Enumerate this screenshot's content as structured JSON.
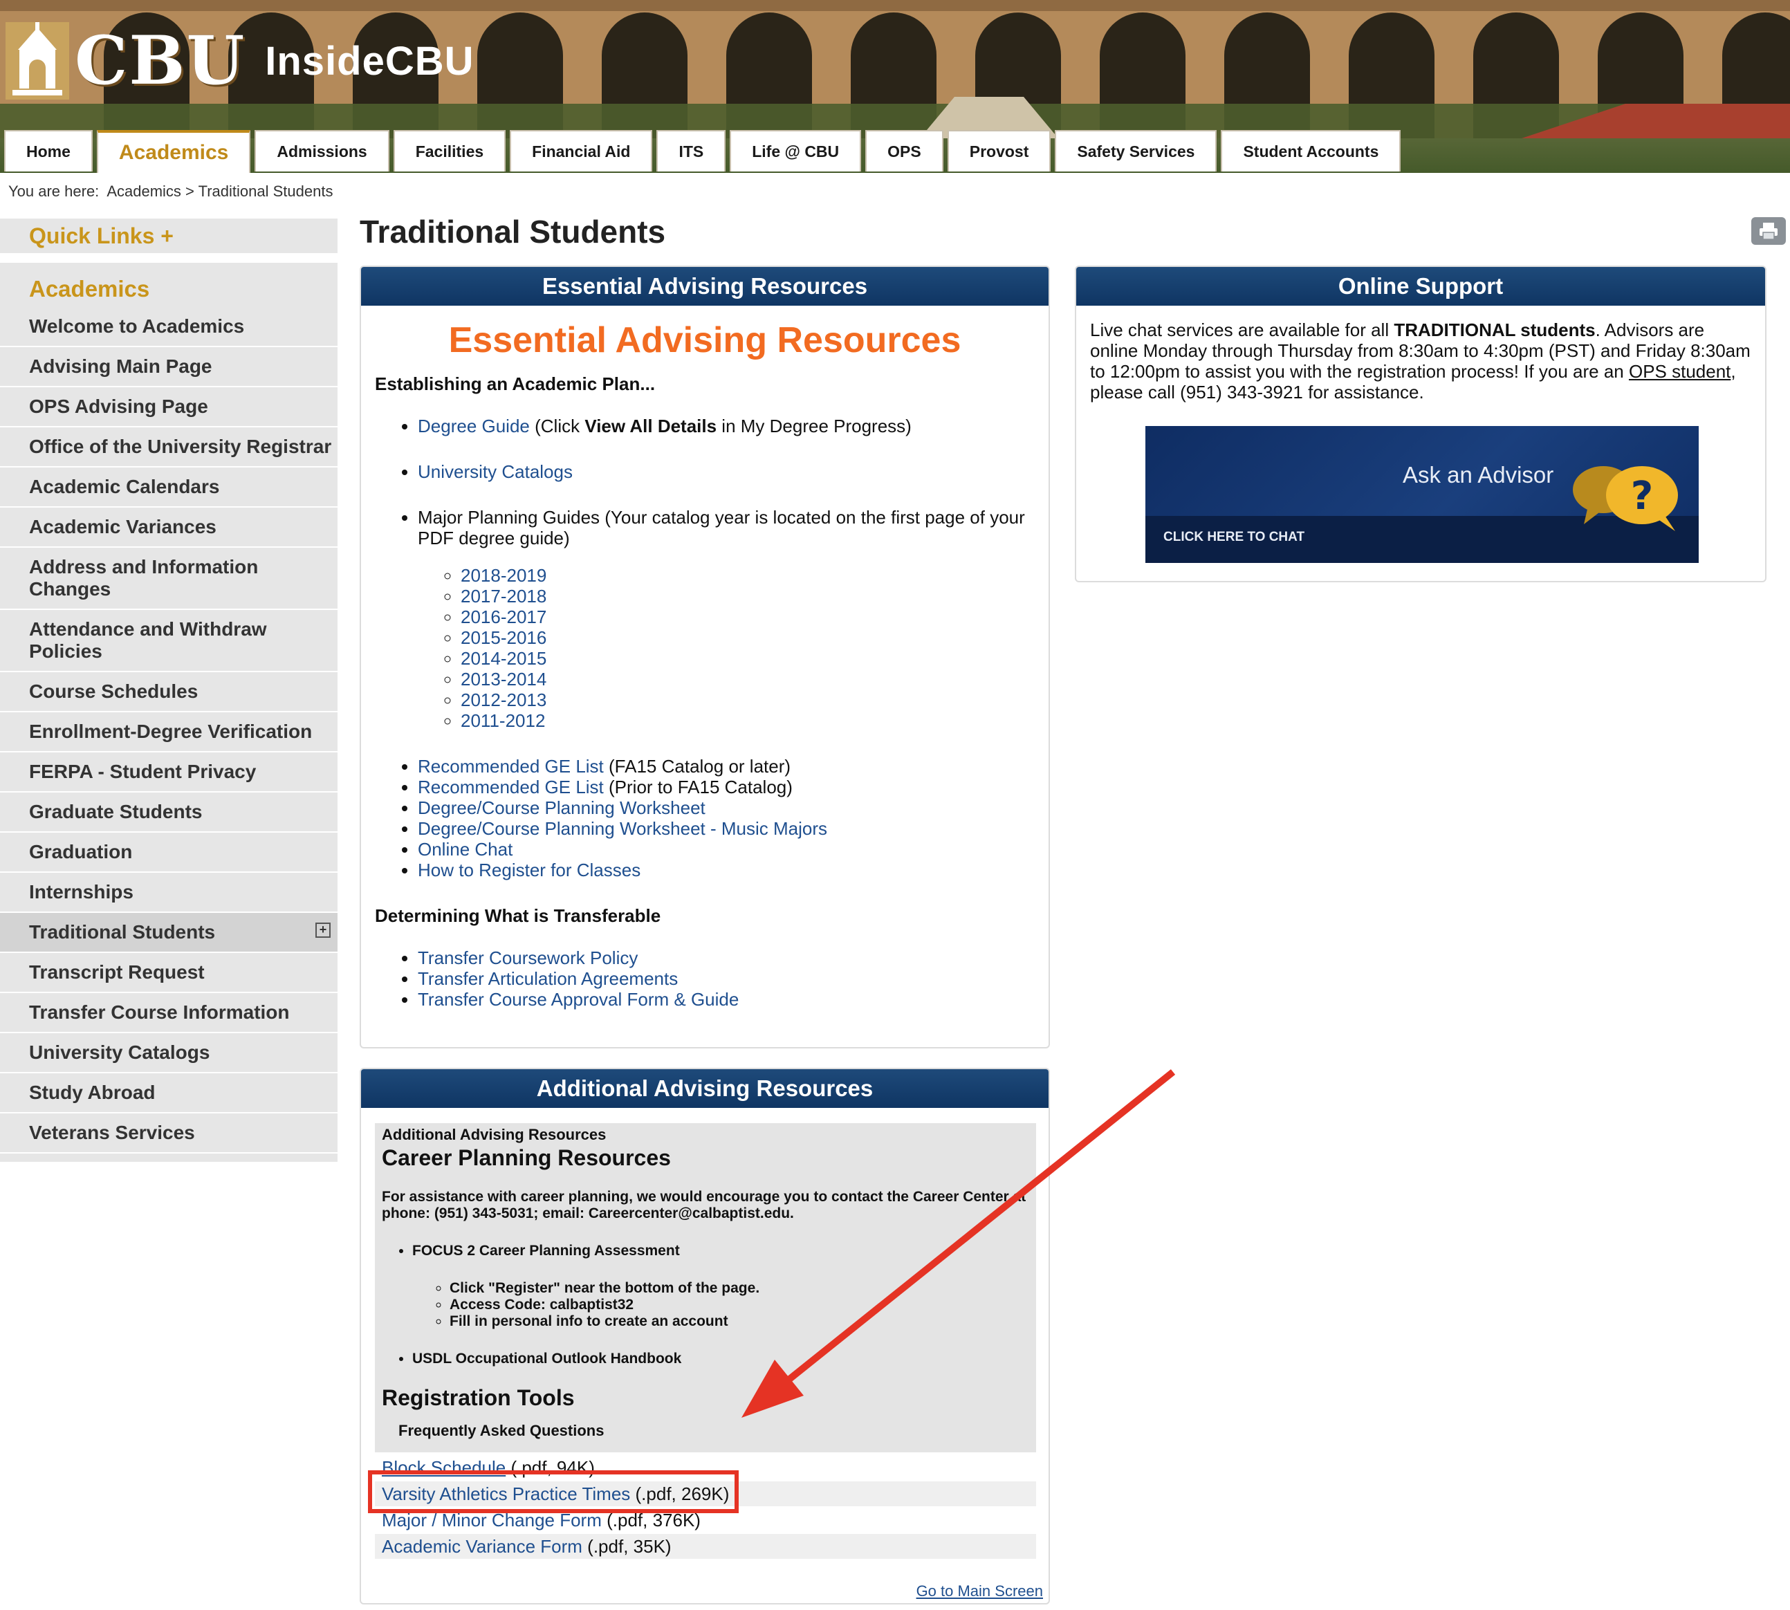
{
  "header": {
    "logo_text": "CBU",
    "site_name": "InsideCBU"
  },
  "tabs": [
    {
      "label": "Home"
    },
    {
      "label": "Academics",
      "active": true
    },
    {
      "label": "Admissions"
    },
    {
      "label": "Facilities"
    },
    {
      "label": "Financial Aid"
    },
    {
      "label": "ITS"
    },
    {
      "label": "Life @ CBU"
    },
    {
      "label": "OPS"
    },
    {
      "label": "Provost"
    },
    {
      "label": "Safety Services"
    },
    {
      "label": "Student Accounts"
    }
  ],
  "breadcrumb": {
    "prefix": "You are here:",
    "crumb1": "Academics",
    "separator": ">",
    "crumb2": "Traditional Students"
  },
  "sidebar": {
    "quick_links": "Quick Links +",
    "heading": "Academics",
    "items": [
      "Welcome to Academics",
      "Advising Main Page",
      "OPS Advising Page",
      "Office of the University Registrar",
      "Academic Calendars",
      "Academic Variances",
      "Address and Information Changes",
      "Attendance and Withdraw Policies",
      "Course Schedules",
      "Enrollment-Degree Verification",
      "FERPA - Student Privacy",
      "Graduate Students",
      "Graduation",
      "Internships",
      "Traditional Students",
      "Transcript Request",
      "Transfer Course Information",
      "University Catalogs",
      "Study Abroad",
      "Veterans Services"
    ],
    "active_index": 14,
    "expand_symbol": "+"
  },
  "page_title": "Traditional Students",
  "essential": {
    "header": "Essential Advising Resources",
    "big_title": "Essential Advising Resources",
    "section1": "Establishing an Academic Plan...",
    "degree_guide_link": "Degree Guide",
    "degree_guide_pre": " (Click ",
    "degree_guide_bold": "View All Details",
    "degree_guide_post": " in My Degree Progress)",
    "catalogs_link": "University Catalogs",
    "major_planning": "Major Planning Guides (Your catalog year is located on the first page of your PDF degree guide)",
    "years": [
      "2018-2019",
      "2017-2018",
      "2016-2017",
      "2015-2016",
      "2014-2015",
      "2013-2014",
      "2012-2013",
      "2011-2012"
    ],
    "ge1_link": "Recommended GE List",
    "ge1_note": " (FA15 Catalog or later)",
    "ge2_link": "Recommended GE List",
    "ge2_note": " (Prior to FA15 Catalog)",
    "links": [
      "Degree/Course Planning Worksheet",
      "Degree/Course Planning Worksheet - Music Majors",
      "Online Chat",
      "How to Register for Classes"
    ],
    "section2": "Determining What is Transferable",
    "transfer_links": [
      "Transfer Coursework Policy",
      "Transfer Articulation Agreements",
      "Transfer Course Approval Form & Guide"
    ]
  },
  "online_support": {
    "header": "Online Support",
    "text_a": "Live chat services are available for all ",
    "text_bold": "TRADITIONAL students",
    "text_b": ". Advisors are online Monday through Thursday from 8:30am to 4:30pm (PST) and Friday 8:30am to 12:00pm to assist you with the registration process! If you are an ",
    "ops_link": "OPS student",
    "text_c": ", please call (951) 343-3921 for assistance.",
    "banner_title": "Ask an Advisor",
    "banner_sub": "CLICK HERE TO CHAT",
    "bubble_glyph": "?"
  },
  "additional": {
    "header": "Additional Advising Resources",
    "small_title": "Additional Advising Resources",
    "career_title": "Career Planning Resources",
    "career_para": "For assistance with career planning, we would encourage you to contact the Career Center at phone: (951) 343-5031; email: Careercenter@calbaptist.edu.",
    "focus": "FOCUS 2 Career Planning Assessment",
    "focus_steps": [
      "Click \"Register\" near the bottom of the page.",
      "Access Code: calbaptist32",
      "Fill in personal info to create an account"
    ],
    "usdl": "USDL Occupational Outlook Handbook",
    "reg_title": "Registration Tools",
    "faq": "Frequently Asked Questions",
    "downloads": [
      {
        "link": "Block Schedule",
        "meta": " (.pdf, 94K)"
      },
      {
        "link": "Varsity Athletics Practice Times",
        "meta": " (.pdf, 269K)"
      },
      {
        "link": "Major / Minor Change Form",
        "meta": " (.pdf, 376K)"
      },
      {
        "link": "Academic Variance Form",
        "meta": " (.pdf, 35K)"
      }
    ],
    "goto": "Go to Main Screen"
  },
  "colors": {
    "accent_gold": "#c9951b",
    "link_blue": "#1f4f8f",
    "header_navy": "#0f3563",
    "orange_title": "#f26b21",
    "annotation_red": "#e53324"
  }
}
